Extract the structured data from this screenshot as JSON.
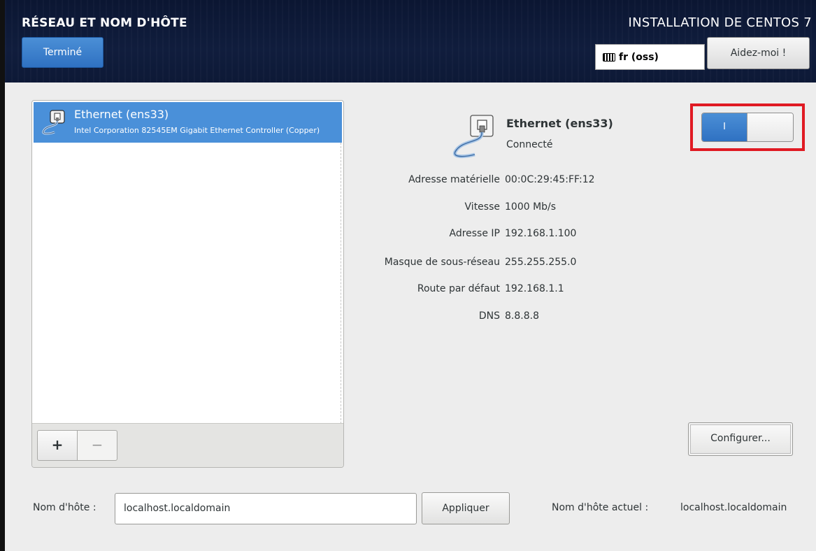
{
  "header": {
    "spoke_title": "RÉSEAU ET NOM D'HÔTE",
    "done_label": "Terminé",
    "product_title": "INSTALLATION DE CENTOS 7",
    "keyboard_layout": "fr (oss)",
    "help_label": "Aidez-moi !"
  },
  "device_list": {
    "items": [
      {
        "name": "Ethernet (ens33)",
        "description": "Intel Corporation 82545EM Gigabit Ethernet Controller (Copper)",
        "selected": true
      }
    ],
    "add_label": "+",
    "remove_label": "−"
  },
  "details": {
    "name": "Ethernet (ens33)",
    "status": "Connecté",
    "rows": [
      {
        "label": "Adresse matérielle",
        "value": "00:0C:29:45:FF:12"
      },
      {
        "label": "Vitesse",
        "value": "1000 Mb/s"
      },
      {
        "label": "Adresse IP",
        "value": "192.168.1.100"
      },
      {
        "label": "Masque de sous-réseau",
        "value": "255.255.255.0"
      },
      {
        "label": "Route par défaut",
        "value": "192.168.1.1"
      },
      {
        "label": "DNS",
        "value": "8.8.8.8"
      }
    ],
    "switch_on_label": "I",
    "switch_state": "on",
    "configure_label": "Configurer..."
  },
  "hostname": {
    "label": "Nom d'hôte :",
    "value": "localhost.localdomain",
    "apply_label": "Appliquer",
    "current_label": "Nom d'hôte actuel :",
    "current_value": "localhost.localdomain"
  },
  "colors": {
    "accent": "#3b82cf",
    "header_bg": "#0e1a38",
    "highlight": "#e01a23",
    "selection": "#4a90d9"
  }
}
